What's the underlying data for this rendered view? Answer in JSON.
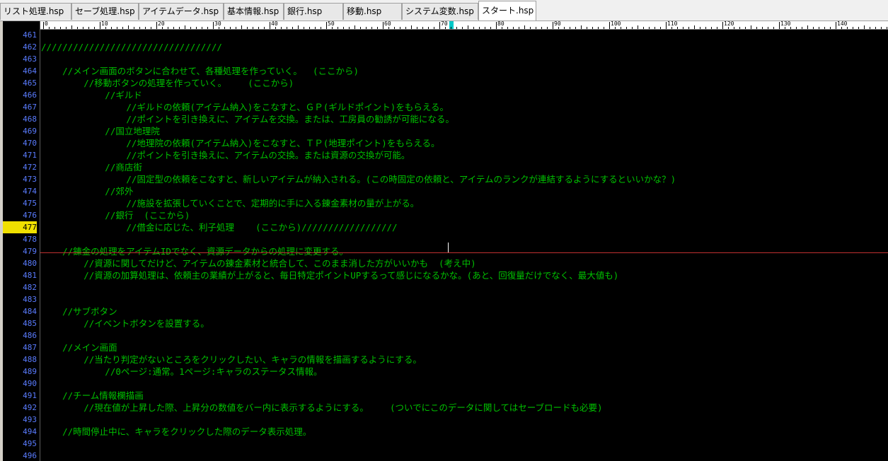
{
  "tabs": [
    {
      "label": "リスト処理.hsp",
      "active": false
    },
    {
      "label": "セーブ処理.hsp",
      "active": false
    },
    {
      "label": "アイテムデータ.hsp",
      "active": false
    },
    {
      "label": "基本情報.hsp",
      "active": false
    },
    {
      "label": "銀行.hsp",
      "active": false
    },
    {
      "label": "移動.hsp",
      "active": false
    },
    {
      "label": "システム変数.hsp",
      "active": false
    },
    {
      "label": "スタート.hsp",
      "active": true
    }
  ],
  "ruler": {
    "labels": [
      "0",
      "10",
      "20",
      "30",
      "40",
      "50",
      "60",
      "70",
      "80",
      "90",
      "100",
      "110",
      "120",
      "130",
      "140"
    ],
    "caret_column": 72
  },
  "editor": {
    "current_line": "477",
    "colors": {
      "background": "#000000",
      "code": "#00c000",
      "line_number": "#5a7cff",
      "current_line_highlight": "#f0e000"
    },
    "lines": [
      {
        "num": "461",
        "text": ""
      },
      {
        "num": "462",
        "text": "//////////////////////////////////"
      },
      {
        "num": "463",
        "text": ""
      },
      {
        "num": "464",
        "text": "    //メイン画面のボタンに合わせて、各種処理を作っていく。  (ここから)"
      },
      {
        "num": "465",
        "text": "        //移動ボタンの処理を作っていく。    (ここから)"
      },
      {
        "num": "466",
        "text": "            //ギルド"
      },
      {
        "num": "467",
        "text": "                //ギルドの依頼(アイテム納入)をこなすと、ＧＰ(ギルドポイント)をもらえる。"
      },
      {
        "num": "468",
        "text": "                //ポイントを引き換えに、アイテムを交換。または、工房員の勧誘が可能になる。"
      },
      {
        "num": "469",
        "text": "            //国立地理院"
      },
      {
        "num": "470",
        "text": "                //地理院の依頼(アイテム納入)をこなすと、ＴＰ(地理ポイント)をもらえる。"
      },
      {
        "num": "471",
        "text": "                //ポイントを引き換えに、アイテムの交換。または資源の交換が可能。"
      },
      {
        "num": "472",
        "text": "            //商店街"
      },
      {
        "num": "473",
        "text": "                //固定型の依頼をこなすと、新しいアイテムが納入される。(この時固定の依頼と、アイテムのランクが連結するようにするといいかな？)"
      },
      {
        "num": "474",
        "text": "            //郊外"
      },
      {
        "num": "475",
        "text": "                //施設を拡張していくことで、定期的に手に入る錬金素材の量が上がる。"
      },
      {
        "num": "476",
        "text": "            //銀行  (ここから)"
      },
      {
        "num": "477",
        "text": "                //借金に応じた、利子処理    (ここから)//////////////////"
      },
      {
        "num": "478",
        "text": ""
      },
      {
        "num": "479",
        "text": "    //錬金の処理をアイテムIDでなく、資源データからの処理に変更する。"
      },
      {
        "num": "480",
        "text": "        //資源に関してだけど、アイテムの錬金素材と統合して、このまま消した方がいいかも  (考え中)"
      },
      {
        "num": "481",
        "text": "        //資源の加算処理は、依頼主の業績が上がると、毎日特定ポイントUPするって感じになるかな。(あと、回復量だけでなく、最大値も)"
      },
      {
        "num": "482",
        "text": ""
      },
      {
        "num": "483",
        "text": ""
      },
      {
        "num": "484",
        "text": "    //サブボタン"
      },
      {
        "num": "485",
        "text": "        //イベントボタンを設置する。"
      },
      {
        "num": "486",
        "text": ""
      },
      {
        "num": "487",
        "text": "    //メイン画面"
      },
      {
        "num": "488",
        "text": "        //当たり判定がないところをクリックしたい、キャラの情報を描画するようにする。"
      },
      {
        "num": "489",
        "text": "            //0ページ:通常。1ページ:キャラのステータス情報。"
      },
      {
        "num": "490",
        "text": ""
      },
      {
        "num": "491",
        "text": "    //チーム情報欄描画"
      },
      {
        "num": "492",
        "text": "        //現在値が上昇した際、上昇分の数値をバー内に表示するようにする。    (ついでにこのデータに関してはセーブロードも必要)"
      },
      {
        "num": "493",
        "text": ""
      },
      {
        "num": "494",
        "text": "    //時間停止中に、キャラをクリックした際のデータ表示処理。"
      },
      {
        "num": "495",
        "text": ""
      },
      {
        "num": "496",
        "text": ""
      }
    ]
  }
}
